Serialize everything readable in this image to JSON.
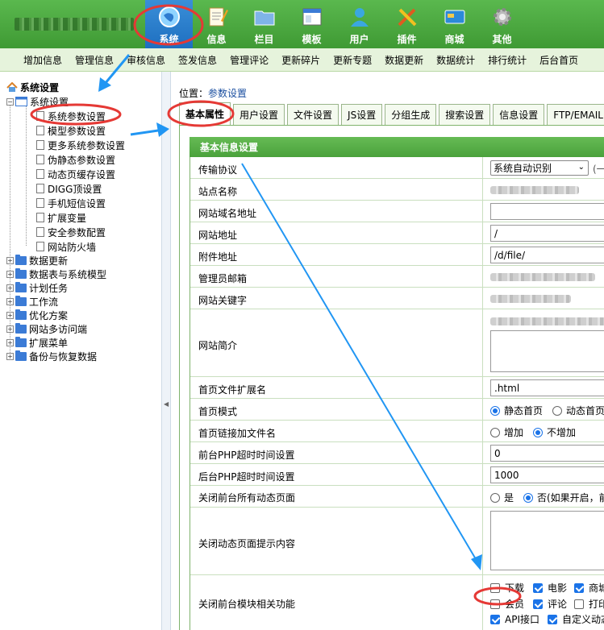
{
  "top_nav": {
    "items": [
      {
        "label": "系统",
        "icon": "globe-icon",
        "active": true
      },
      {
        "label": "信息",
        "icon": "notepad-icon"
      },
      {
        "label": "栏目",
        "icon": "folder-icon"
      },
      {
        "label": "模板",
        "icon": "window-icon"
      },
      {
        "label": "用户",
        "icon": "user-icon"
      },
      {
        "label": "插件",
        "icon": "tools-icon"
      },
      {
        "label": "商城",
        "icon": "card-icon"
      },
      {
        "label": "其他",
        "icon": "gear-icon"
      }
    ]
  },
  "sub_nav": {
    "items": [
      "增加信息",
      "管理信息",
      "审核信息",
      "签发信息",
      "管理评论",
      "更新碎片",
      "更新专题",
      "数据更新",
      "数据统计",
      "排行统计",
      "后台首页"
    ]
  },
  "tree": {
    "root": "系统设置",
    "group": "系统设置",
    "children": [
      "系统参数设置",
      "模型参数设置",
      "更多系统参数设置",
      "伪静态参数设置",
      "动态页缓存设置",
      "DIGG顶设置",
      "手机短信设置",
      "扩展变量",
      "安全参数配置",
      "网站防火墙"
    ],
    "folders": [
      "数据更新",
      "数据表与系统模型",
      "计划任务",
      "工作流",
      "优化方案",
      "网站多访问端",
      "扩展菜单",
      "备份与恢复数据"
    ]
  },
  "breadcrumb": {
    "prefix": "位置：",
    "current": "参数设置"
  },
  "tabs": [
    "基本属性",
    "用户设置",
    "文件设置",
    "JS设置",
    "分组生成",
    "搜索设置",
    "信息设置",
    "FTP/EMAIL"
  ],
  "panel": {
    "title": "基本信息设置",
    "rows": {
      "protocol": {
        "label": "传输协议",
        "select": "系统自动识别",
        "hint": "(一般"
      },
      "site_name": {
        "label": "站点名称"
      },
      "domain": {
        "label": "网站域名地址",
        "value": ""
      },
      "site_url": {
        "label": "网站地址",
        "value": "/"
      },
      "attach_url": {
        "label": "附件地址",
        "value": "/d/file/"
      },
      "admin_email": {
        "label": "管理员邮箱"
      },
      "keywords": {
        "label": "网站关键字"
      },
      "intro": {
        "label": "网站简介"
      },
      "index_ext": {
        "label": "首页文件扩展名",
        "value": ".html"
      },
      "index_mode": {
        "label": "首页模式",
        "opt1": "静态首页",
        "opt2": "动态首页"
      },
      "index_link": {
        "label": "首页链接加文件名",
        "opt1": "增加",
        "opt2": "不增加"
      },
      "front_timeout": {
        "label": "前台PHP超时时间设置",
        "value": "0"
      },
      "back_timeout": {
        "label": "后台PHP超时时间设置",
        "value": "1000"
      },
      "close_dynamic": {
        "label": "关闭前台所有动态页面",
        "opt1": "是",
        "opt2": "否(如果开启，前"
      },
      "close_tip": {
        "label": "关闭动态页面提示内容"
      },
      "close_modules": {
        "label": "关闭前台模块相关功能",
        "line1": [
          "下载",
          "电影",
          "商城"
        ],
        "line2": [
          "会员",
          "评论",
          "打印"
        ],
        "line3": [
          "API接口",
          "自定义动态"
        ]
      }
    }
  },
  "colors": {
    "accent": "#4aa23c",
    "highlight": "#e53935",
    "arrow": "#2196f3"
  }
}
